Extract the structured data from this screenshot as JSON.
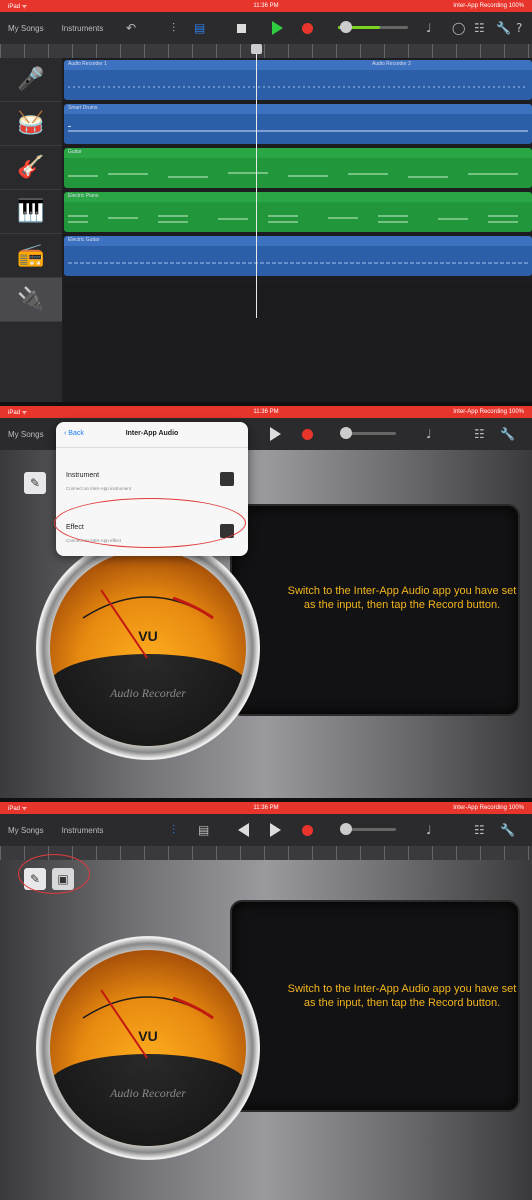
{
  "colors": {
    "status_bar": "#e8352c",
    "play": "#2ecc40",
    "record": "#e8352c",
    "track_blue": "#2c5fa8",
    "track_green": "#21963a",
    "screen_text": "#f2b51c",
    "annotation": "#e03a3a"
  },
  "panel1": {
    "status": {
      "carrier": "iPad ᯤ",
      "time": "11:36 PM",
      "right": "Inter-App Recording 100%"
    },
    "nav": {
      "my_songs": "My Songs",
      "section": "Instruments"
    },
    "tracks": [
      {
        "icon": "microphone-icon",
        "glyph": "🎤",
        "color": "blue",
        "region": "Audio Recorder 1",
        "region2": "Audio Recorder 2"
      },
      {
        "icon": "drums-icon",
        "glyph": "🥁",
        "color": "blue",
        "region": "Smart Drums"
      },
      {
        "icon": "guitar-icon",
        "glyph": "🎸",
        "color": "green",
        "region": "Guitar"
      },
      {
        "icon": "keyboard-icon",
        "glyph": "🎹",
        "color": "green",
        "region": "Electric Piano"
      },
      {
        "icon": "amp-icon",
        "glyph": "📻",
        "color": "blue",
        "region": "Electric Guitar"
      },
      {
        "icon": "inter-app-icon",
        "glyph": "🔌",
        "color": "none",
        "region": ""
      }
    ]
  },
  "panel2": {
    "status": {
      "carrier": "iPad ᯤ",
      "time": "11:36 PM",
      "right": "Inter-App Recording 100%"
    },
    "nav": {
      "my_songs": "My Songs"
    },
    "popover": {
      "back": "Back",
      "title": "Inter-App Audio",
      "items": [
        {
          "name": "Instrument",
          "sub": "Connect an Inter-App instrument"
        },
        {
          "name": "Effect",
          "sub": "Connect an Inter-App effect"
        }
      ]
    },
    "vu_label": "VU",
    "brand": "Audio Recorder",
    "message": "Switch to the Inter-App Audio app you have set as the input, then tap the Record button."
  },
  "panel3": {
    "status": {
      "carrier": "iPad ᯤ",
      "time": "11:36 PM",
      "right": "Inter-App Recording 100%"
    },
    "nav": {
      "my_songs": "My Songs",
      "section": "Instruments"
    },
    "vu_label": "VU",
    "brand": "Audio Recorder",
    "message": "Switch to the Inter-App Audio app you have set as the input, then tap the Record button."
  }
}
